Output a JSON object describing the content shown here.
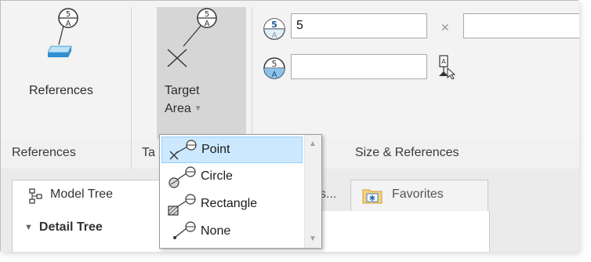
{
  "ribbon": {
    "references_button": "References",
    "target_area_button_line1": "Target",
    "target_area_button_line2": "Area",
    "size_value": "5",
    "second_value": ""
  },
  "groups": {
    "references": "References",
    "target_partial": "Ta",
    "size_references": "Size & References"
  },
  "dropdown": {
    "items": [
      {
        "label": "Point",
        "icon": "point-target-icon",
        "selected": true
      },
      {
        "label": "Circle",
        "icon": "circle-target-icon",
        "selected": false
      },
      {
        "label": "Rectangle",
        "icon": "rectangle-target-icon",
        "selected": false
      },
      {
        "label": "None",
        "icon": "none-target-icon",
        "selected": false
      }
    ]
  },
  "panel": {
    "tabs": [
      {
        "label": "Model Tree",
        "icon": "model-tree-icon"
      },
      {
        "label": "s...",
        "icon": ""
      },
      {
        "label": "Favorites",
        "icon": "favorites-folder-icon"
      }
    ],
    "tree_heading": "Detail Tree"
  },
  "colors": {
    "datum_symbol": "#4d7fb8",
    "selected_item": "#cce8ff",
    "highlighted_button": "#d6d6d6"
  }
}
